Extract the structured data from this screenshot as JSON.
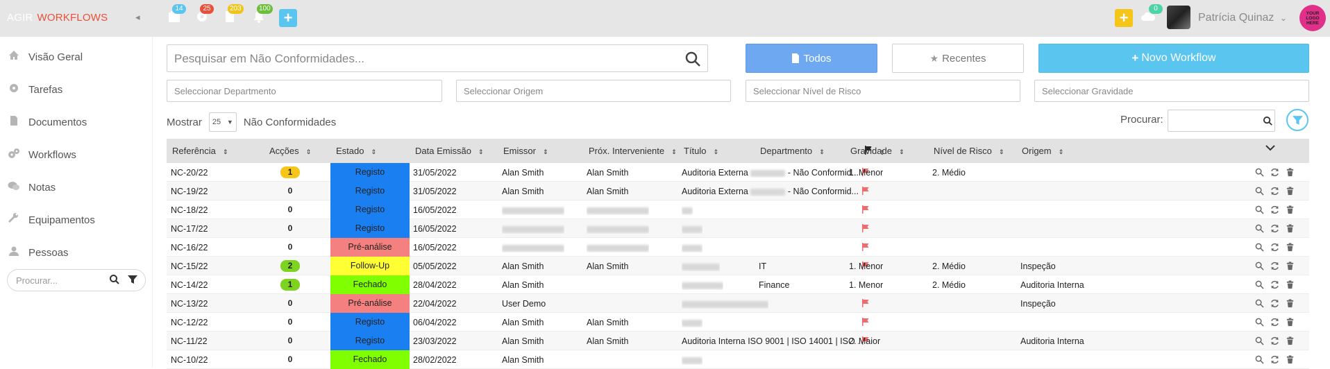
{
  "topbar": {
    "brand_agir": "AGIR",
    "brand_workflows": "WORKFLOWS",
    "collapse_glyph": "◂",
    "badges": [
      {
        "icon": "calendar-icon",
        "count": "14",
        "color": "#5ac6ef"
      },
      {
        "icon": "gear-icon",
        "count": "25",
        "color": "#e8503a"
      },
      {
        "icon": "document-icon",
        "count": "203",
        "color": "#f0c419"
      },
      {
        "icon": "bell-icon",
        "count": "100",
        "color": "#6cbf3a"
      }
    ],
    "cloud_count": "0",
    "user_name": "Patrícia Quinaz",
    "logo_text": "YOUR LOGO HERE"
  },
  "sidebar": {
    "items": [
      {
        "label": "Visão Geral",
        "icon": "home-icon"
      },
      {
        "label": "Tarefas",
        "icon": "gear-icon"
      },
      {
        "label": "Documentos",
        "icon": "document-icon"
      },
      {
        "label": "Workflows",
        "icon": "gears-icon"
      },
      {
        "label": "Notas",
        "icon": "comments-icon"
      },
      {
        "label": "Equipamentos",
        "icon": "wrench-icon"
      },
      {
        "label": "Pessoas",
        "icon": "user-icon"
      }
    ],
    "search_placeholder": "Procurar..."
  },
  "main": {
    "search_placeholder": "Pesquisar em Não Conformidades...",
    "btn_todos": "Todos",
    "btn_recentes": "Recentes",
    "btn_novo": "Novo Workflow",
    "filters": [
      "Seleccionar Departmento",
      "Seleccionar Origem",
      "Seleccionar Nível de Risco",
      "Seleccionar Gravidade"
    ],
    "show_label": "Mostrar",
    "page_length": "25",
    "show_suffix": "Não Conformidades",
    "procurar_label": "Procurar:"
  },
  "table": {
    "headers": [
      "Referência",
      "Acções",
      "Estado",
      "Data Emissão",
      "Emissor",
      "Próx. Interveniente",
      "Título",
      "",
      "Departmento",
      "Gravidade",
      "Nível de Risco",
      "Origem"
    ],
    "rows": [
      {
        "ref": "NC-20/22",
        "acc": "1",
        "acc_color": "#f5c518",
        "estado": "Registo",
        "estado_color": "#1a7ff0",
        "data": "31/05/2022",
        "emissor": "Alan Smith",
        "prox": "Alan Smith",
        "titulo": "Auditoria Externa",
        "titulo_suffix": "- Não Conformid...",
        "flag": true,
        "dep": "",
        "grav": "1. Menor",
        "risco": "2. Médio",
        "origem": ""
      },
      {
        "ref": "NC-19/22",
        "acc": "0",
        "acc_color": "",
        "estado": "Registo",
        "estado_color": "#1a7ff0",
        "data": "31/05/2022",
        "emissor": "Alan Smith",
        "prox": "Alan Smith",
        "titulo": "Auditoria Externa",
        "titulo_suffix": "- Não Conformid...",
        "flag": true,
        "dep": "",
        "grav": "",
        "risco": "",
        "origem": ""
      },
      {
        "ref": "NC-18/22",
        "acc": "0",
        "acc_color": "",
        "estado": "Registo",
        "estado_color": "#1a7ff0",
        "data": "16/05/2022",
        "emissor": "",
        "prox": "",
        "titulo": "",
        "titulo_suffix": "",
        "flag": true,
        "dep": "",
        "grav": "",
        "risco": "",
        "origem": ""
      },
      {
        "ref": "NC-17/22",
        "acc": "0",
        "acc_color": "",
        "estado": "Registo",
        "estado_color": "#1a7ff0",
        "data": "16/05/2022",
        "emissor": "",
        "prox": "",
        "titulo": "",
        "titulo_suffix": "",
        "flag": true,
        "dep": "",
        "grav": "",
        "risco": "",
        "origem": ""
      },
      {
        "ref": "NC-16/22",
        "acc": "0",
        "acc_color": "",
        "estado": "Pré-análise",
        "estado_color": "#f48080",
        "data": "16/05/2022",
        "emissor": "",
        "prox": "",
        "titulo": "",
        "titulo_suffix": "",
        "flag": true,
        "dep": "",
        "grav": "",
        "risco": "",
        "origem": ""
      },
      {
        "ref": "NC-15/22",
        "acc": "2",
        "acc_color": "#7ed321",
        "estado": "Follow-Up",
        "estado_color": "#ffff33",
        "data": "05/05/2022",
        "emissor": "Alan Smith",
        "prox": "Alan Smith",
        "titulo": "",
        "titulo_suffix": "",
        "flag": true,
        "dep": "IT",
        "grav": "1. Menor",
        "risco": "2. Médio",
        "origem": "Inspeção"
      },
      {
        "ref": "NC-14/22",
        "acc": "1",
        "acc_color": "#7ed321",
        "estado": "Fechado",
        "estado_color": "#7fff00",
        "data": "28/04/2022",
        "emissor": "Alan Smith",
        "prox": "",
        "titulo": "",
        "titulo_suffix": "",
        "flag": false,
        "dep": "Finance",
        "grav": "1. Menor",
        "risco": "2. Médio",
        "origem": "Auditoria Interna"
      },
      {
        "ref": "NC-13/22",
        "acc": "0",
        "acc_color": "",
        "estado": "Pré-análise",
        "estado_color": "#f48080",
        "data": "22/04/2022",
        "emissor": "User Demo",
        "prox": "",
        "titulo": "",
        "titulo_suffix": "",
        "flag": true,
        "dep": "",
        "grav": "",
        "risco": "",
        "origem": "Inspeção"
      },
      {
        "ref": "NC-12/22",
        "acc": "0",
        "acc_color": "",
        "estado": "Registo",
        "estado_color": "#1a7ff0",
        "data": "06/04/2022",
        "emissor": "Alan Smith",
        "prox": "Alan Smith",
        "titulo": "",
        "titulo_suffix": "",
        "flag": true,
        "dep": "",
        "grav": "",
        "risco": "",
        "origem": ""
      },
      {
        "ref": "NC-11/22",
        "acc": "0",
        "acc_color": "",
        "estado": "Registo",
        "estado_color": "#1a7ff0",
        "data": "23/03/2022",
        "emissor": "Alan Smith",
        "prox": "Alan Smith",
        "titulo": "Auditoria Interna ISO 9001 | ISO 14001 | ISO ...",
        "titulo_suffix": "",
        "flag": true,
        "dep": "",
        "grav": "2. Maior",
        "risco": "",
        "origem": "Auditoria Interna"
      },
      {
        "ref": "NC-10/22",
        "acc": "0",
        "acc_color": "",
        "estado": "Fechado",
        "estado_color": "#7fff00",
        "data": "28/02/2022",
        "emissor": "Alan Smith",
        "prox": "",
        "titulo": "",
        "titulo_suffix": "",
        "flag": false,
        "dep": "",
        "grav": "",
        "risco": "",
        "origem": ""
      }
    ]
  },
  "colors": {
    "accent_blue": "#6ea8f0",
    "accent_cyan": "#5ac6ef",
    "brand_red": "#e8503a",
    "flag_red": "#f06b6b"
  }
}
